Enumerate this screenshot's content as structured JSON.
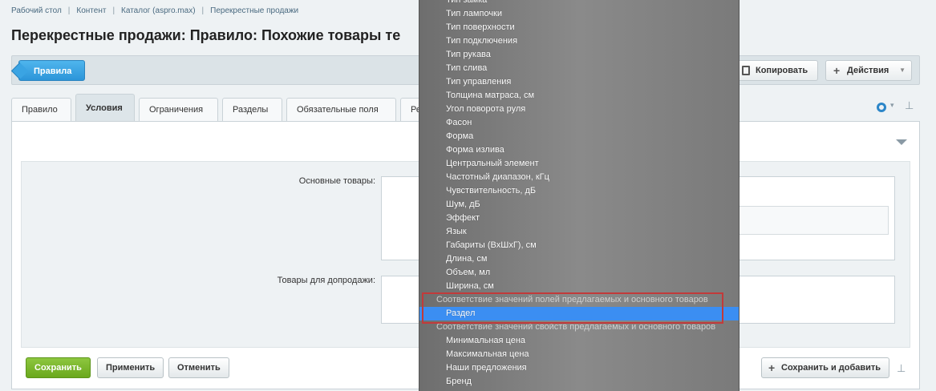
{
  "breadcrumbs": [
    "Рабочий стол",
    "Контент",
    "Каталог (aspro.max)",
    "Перекрестные продажи"
  ],
  "page_title": "Перекрестные продажи: Правило: Похожие товары те",
  "toolbar": {
    "rules_button": "Правила",
    "copy_button": "Копировать",
    "actions_button": "Действия"
  },
  "tabs": [
    "Правило",
    "Условия",
    "Ограничения",
    "Разделы",
    "Обязательные поля",
    "Ре"
  ],
  "form": {
    "main_products_label": "Основные товары:",
    "upsell_products_label": "Товары для допродажи:"
  },
  "actions": {
    "save": "Сохранить",
    "apply": "Применить",
    "cancel": "Отменить",
    "save_and_add": "Сохранить и добавить"
  },
  "dropdown": {
    "options_top": [
      "Тип замка",
      "Тип лампочки",
      "Тип поверхности",
      "Тип подключения",
      "Тип рукава",
      "Тип слива",
      "Тип управления",
      "Толщина матраса, см",
      "Угол поворота руля",
      "Фасон",
      "Форма",
      "Форма излива",
      "Центральный элемент",
      "Частотный диапазон, кГц",
      "Чувствительность, дБ",
      "Шум, дБ",
      "Эффект",
      "Язык",
      "Габариты (ВхШхГ), см",
      "Длина, см",
      "Объем, мл",
      "Ширина, см"
    ],
    "group_fields": "Соответствие значений полей предлагаемых и основного товаров",
    "selected_option": "Раздел",
    "group_properties": "Соответствие значений свойств предлагаемых и основного товаров",
    "options_bottom": [
      "Минимальная цена",
      "Максимальная цена",
      "Наши предложения",
      "Бренд"
    ]
  },
  "colors": {
    "primary_blue": "#2c95d9",
    "save_green": "#6aa81c",
    "selected_option": "#3b8ef2",
    "highlight_red": "#c23a3a"
  }
}
